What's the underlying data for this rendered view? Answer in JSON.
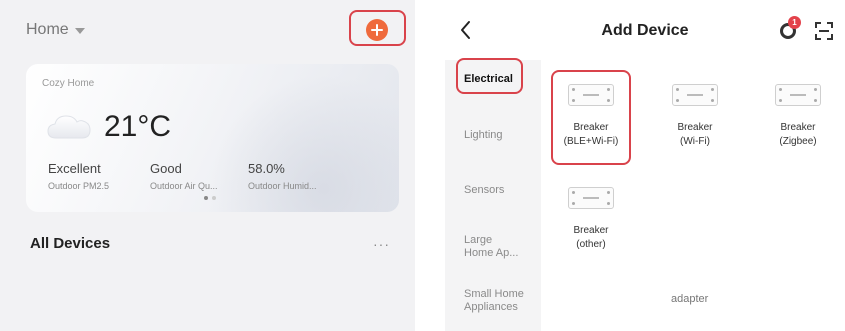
{
  "home": {
    "selector": "Home",
    "weather": {
      "home_name": "Cozy Home",
      "temperature": "21°C",
      "stats": [
        {
          "value": "Excellent",
          "label": "Outdoor PM2.5"
        },
        {
          "value": "Good",
          "label": "Outdoor Air Qu..."
        },
        {
          "value": "58.0%",
          "label": "Outdoor Humid..."
        }
      ]
    },
    "all_devices": "All Devices",
    "more": "···"
  },
  "add_device": {
    "title": "Add Device",
    "badge": "1",
    "categories": [
      {
        "label": "Electrical",
        "active": true
      },
      {
        "label": "Lighting",
        "active": false
      },
      {
        "label": "Sensors",
        "active": false
      },
      {
        "label": "Large\nHome Ap...",
        "active": false
      },
      {
        "label": "Small Home\nAppliances",
        "active": false
      }
    ],
    "devices": [
      {
        "name": "Breaker\n(BLE+Wi-Fi)"
      },
      {
        "name": "Breaker\n(Wi-Fi)"
      },
      {
        "name": "Breaker\n(Zigbee)"
      },
      {
        "name": "Breaker\n(other)"
      }
    ],
    "adapter": "adapter"
  },
  "colors": {
    "accent": "#ef6a3c",
    "highlight": "#d9434b",
    "badge": "#e3424b"
  }
}
